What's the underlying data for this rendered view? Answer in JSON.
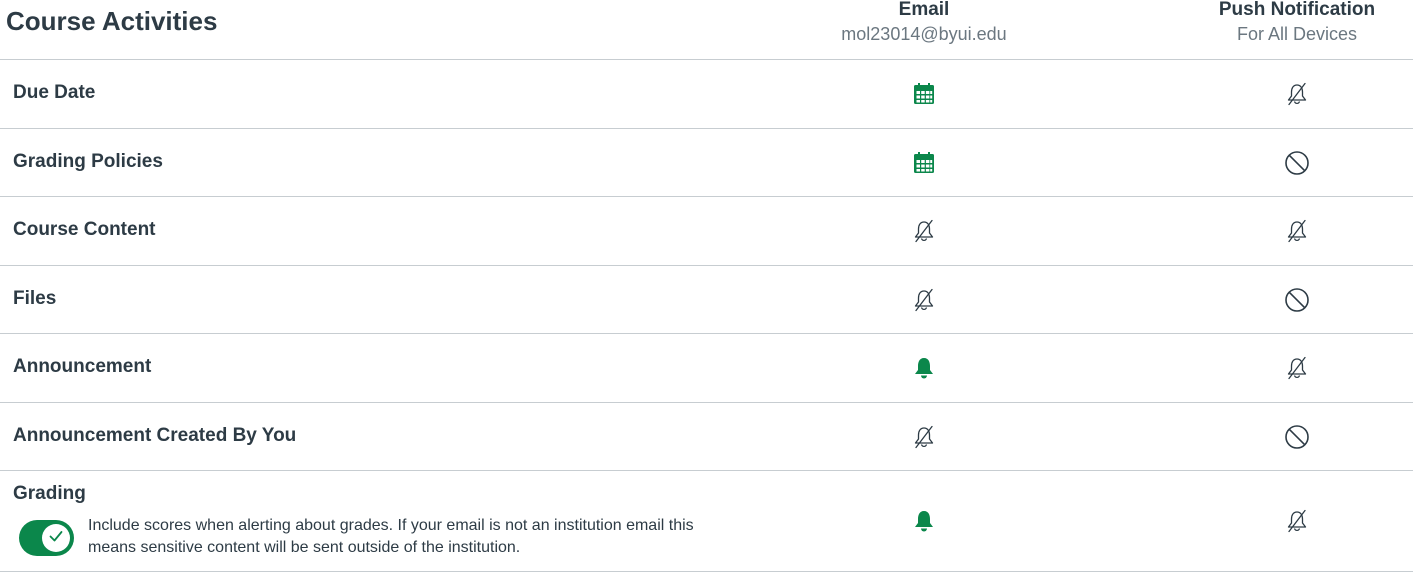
{
  "section": {
    "title": "Course Activities"
  },
  "columns": {
    "email": {
      "title": "Email",
      "subtitle": "mol23014@byui.edu"
    },
    "push": {
      "title": "Push Notification",
      "subtitle": "For All Devices"
    }
  },
  "rows": [
    {
      "label": "Due Date",
      "email": "calendar-weekly-icon",
      "push": "bell-off-icon"
    },
    {
      "label": "Grading Policies",
      "email": "calendar-weekly-icon",
      "push": "disabled-icon"
    },
    {
      "label": "Course Content",
      "email": "bell-off-icon",
      "push": "bell-off-icon"
    },
    {
      "label": "Files",
      "email": "bell-off-icon",
      "push": "disabled-icon"
    },
    {
      "label": "Announcement",
      "email": "bell-filled-icon",
      "push": "bell-off-icon"
    },
    {
      "label": "Announcement Created By You",
      "email": "bell-off-icon",
      "push": "disabled-icon"
    },
    {
      "label": "Grading",
      "email": "bell-filled-icon",
      "push": "bell-off-icon"
    }
  ],
  "grading_toggle": {
    "checked": true,
    "text": "Include scores when alerting about grades. If your email is not an institution email this means sensitive content will be sent outside of the institution."
  },
  "colors": {
    "accent": "#0b874b",
    "icon_gray": "#2d3b45",
    "divider": "#c7cdd1"
  }
}
